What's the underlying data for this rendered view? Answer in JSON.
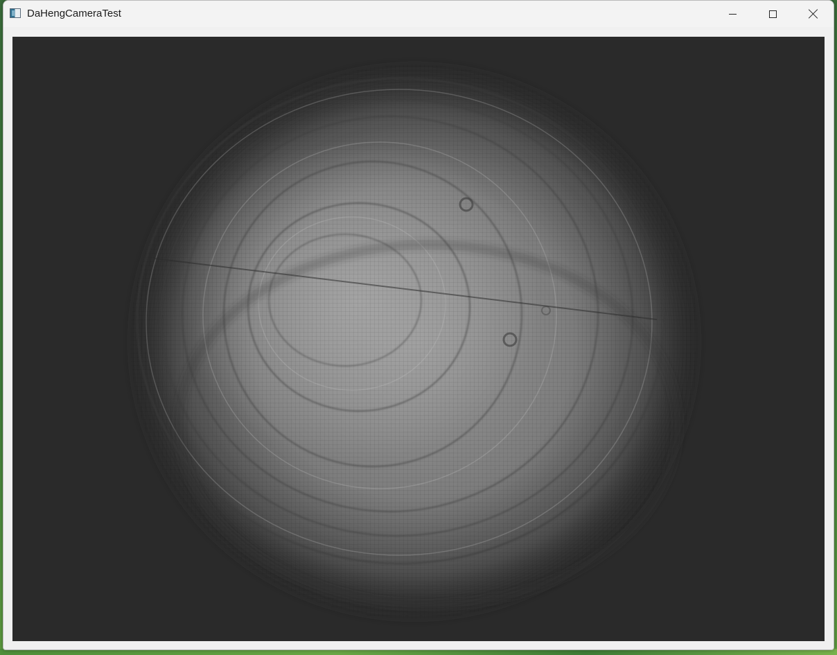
{
  "window": {
    "title": "DaHengCameraTest",
    "icon": "app-icon"
  },
  "controls": {
    "minimize_icon": "minimize-icon",
    "maximize_icon": "maximize-icon",
    "close_icon": "close-icon"
  },
  "camera_view": {
    "background_color": "#2a2a2a",
    "spot_color": "#bdbdbd"
  }
}
